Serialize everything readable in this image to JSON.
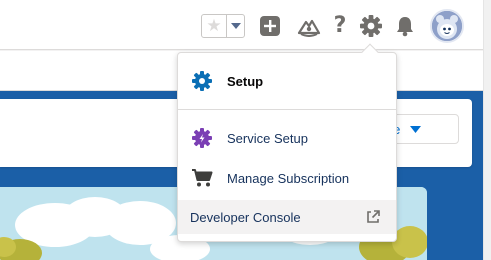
{
  "header": {
    "favorite_star_icon": "star-icon",
    "favorites_menu_icon": "caret-down-icon",
    "global_actions_icon": "plus-icon",
    "trailhead_icon": "trailhead-icon",
    "help_glyph": "?",
    "setup_icon": "gear-icon",
    "notifications_icon": "bell-icon",
    "avatar_icon": "user-avatar"
  },
  "background": {
    "create_button_label": "eate"
  },
  "setup_menu": {
    "items": [
      {
        "label": "Setup",
        "icon": "gear-icon",
        "color": "#1b96ff"
      },
      {
        "label": "Service Setup",
        "icon": "service-gear-icon",
        "color": "#8a2be2"
      },
      {
        "label": "Manage Subscription",
        "icon": "cart-icon",
        "color": "#3e3e3c"
      },
      {
        "label": "Developer Console",
        "icon": "external-link-icon",
        "color": "#706e6b"
      }
    ]
  },
  "colors": {
    "brand_blue": "#1b5fa7",
    "link_blue": "#0070d2",
    "icon_grey": "#706e6b"
  }
}
